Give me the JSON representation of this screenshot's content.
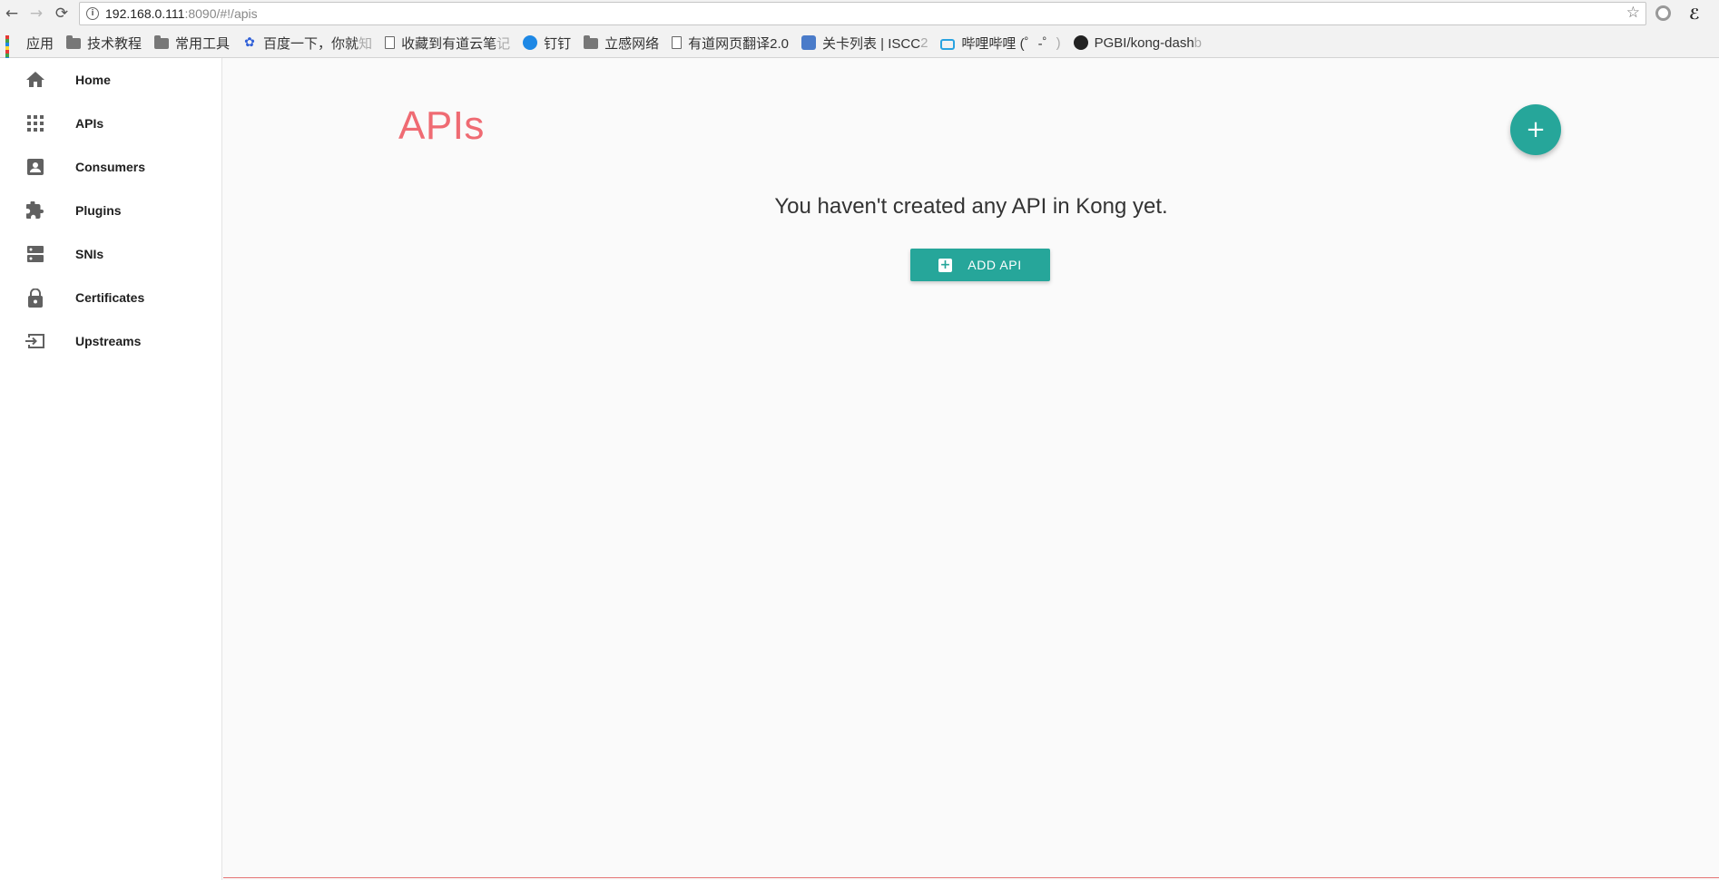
{
  "browser": {
    "url_host": "192.168.0.111",
    "url_path": ":8090/#!/apis",
    "bookmarks": [
      {
        "label": "应用",
        "icon": "apps-grid-icon"
      },
      {
        "label": "技术教程",
        "icon": "folder-icon"
      },
      {
        "label": "常用工具",
        "icon": "folder-icon"
      },
      {
        "label": "百度一下，你就",
        "fade": "知",
        "icon": "baidu-paw-icon"
      },
      {
        "label": "收藏到有道云笔",
        "fade": "记",
        "icon": "page-icon"
      },
      {
        "label": "钉钉",
        "icon": "dingtalk-icon"
      },
      {
        "label": "立感网络",
        "icon": "folder-icon"
      },
      {
        "label": "有道网页翻译2.0",
        "icon": "page-icon"
      },
      {
        "label": "关卡列表 | ISCC",
        "fade": "2",
        "icon": "iscc-icon"
      },
      {
        "label": "哔哩哔哩 (゜-゜",
        "fade": ")",
        "icon": "bilibili-icon"
      },
      {
        "label": "PGBI/kong-dash",
        "fade": "b",
        "icon": "github-icon"
      }
    ]
  },
  "sidebar": {
    "items": [
      {
        "label": "Home",
        "icon": "home-icon"
      },
      {
        "label": "APIs",
        "icon": "apps-grid-icon"
      },
      {
        "label": "Consumers",
        "icon": "account-box-icon"
      },
      {
        "label": "Plugins",
        "icon": "puzzle-icon"
      },
      {
        "label": "SNIs",
        "icon": "dns-icon"
      },
      {
        "label": "Certificates",
        "icon": "lock-icon"
      },
      {
        "label": "Upstreams",
        "icon": "input-icon"
      }
    ]
  },
  "main": {
    "title": "APIs",
    "empty_message": "You haven't created any API in Kong yet.",
    "add_button_label": "ADD API",
    "fab_label": "+"
  },
  "colors": {
    "accent": "#26a69a",
    "title": "#ef6b73"
  }
}
